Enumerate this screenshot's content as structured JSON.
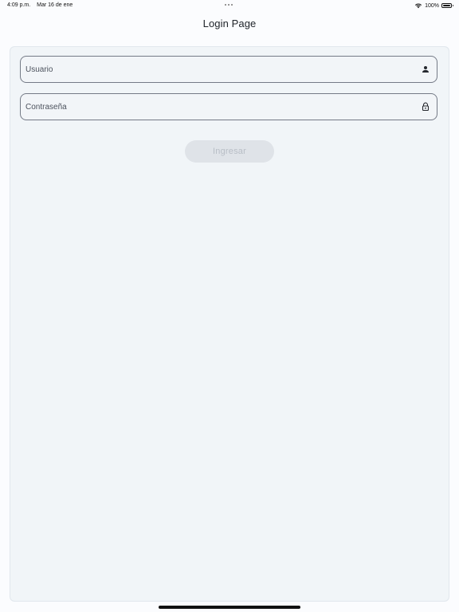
{
  "status_bar": {
    "time": "4:09 p.m.",
    "date": "Mar 16 de ene",
    "battery": "100%",
    "wifi_icon": "wifi-icon",
    "battery_icon": "battery-icon"
  },
  "app_bar": {
    "title": "Login Page"
  },
  "form": {
    "username": {
      "placeholder": "Usuario",
      "value": "",
      "icon": "person-icon"
    },
    "password": {
      "placeholder": "Contraseña",
      "value": "",
      "icon": "lock-icon"
    },
    "submit_label": "Ingresar"
  },
  "colors": {
    "card_background": "#f1f5f8",
    "field_border": "#747a86",
    "button_background": "#dfe3e8",
    "button_text": "#b8bec6"
  }
}
